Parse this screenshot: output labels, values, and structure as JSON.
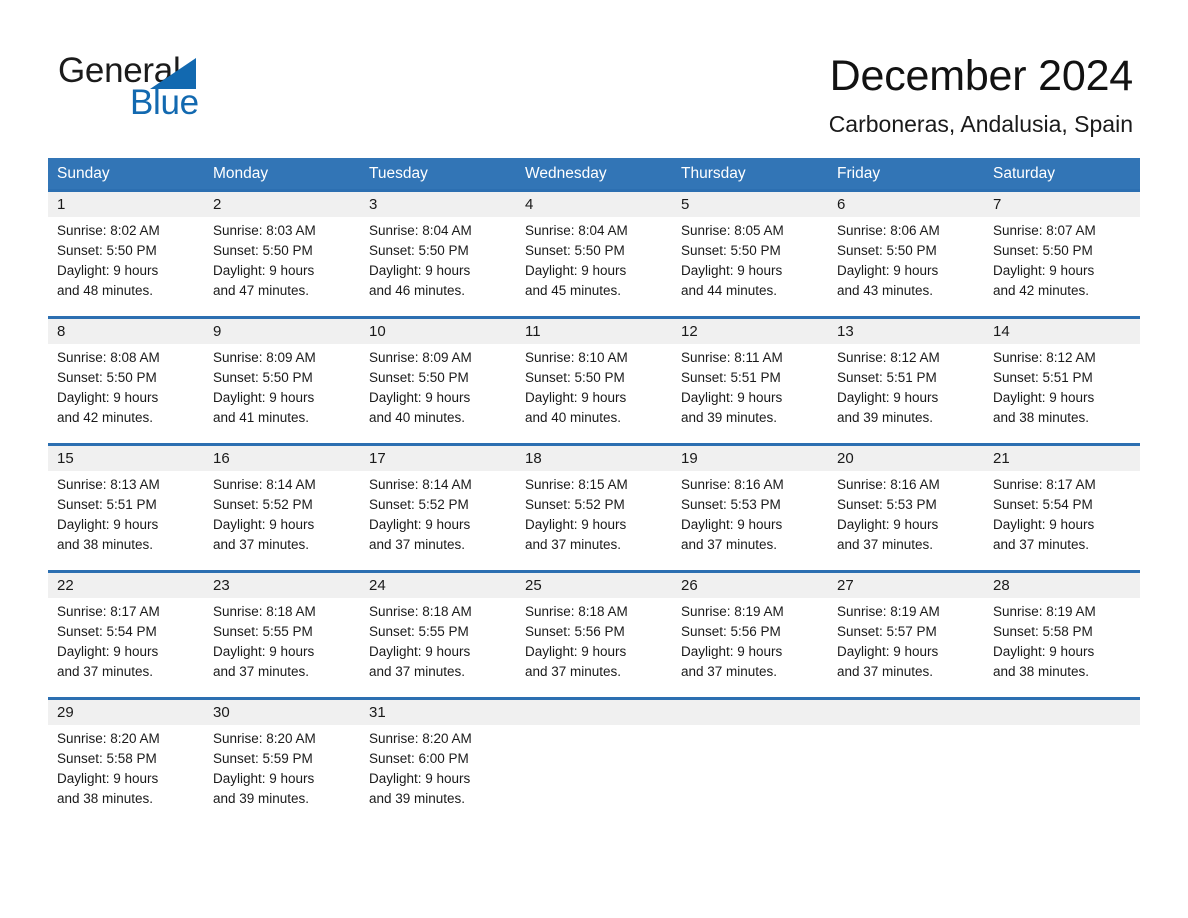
{
  "brand": {
    "name_part1": "General",
    "name_part2": "Blue"
  },
  "header": {
    "month_title": "December 2024",
    "location": "Carboneras, Andalusia, Spain"
  },
  "theme": {
    "header_blue": "#3275b6",
    "row_rule_blue": "#2c6fb1",
    "daynum_band": "#f0f0f0",
    "logo_blue": "#1269b0"
  },
  "weekdays": [
    "Sunday",
    "Monday",
    "Tuesday",
    "Wednesday",
    "Thursday",
    "Friday",
    "Saturday"
  ],
  "labels": {
    "sunrise_prefix": "Sunrise:",
    "sunset_prefix": "Sunset:",
    "daylight_prefix": "Daylight:"
  },
  "weeks": [
    {
      "days": [
        {
          "num": "1",
          "sunrise": "Sunrise: 8:02 AM",
          "sunset": "Sunset: 5:50 PM",
          "daylight1": "Daylight: 9 hours",
          "daylight2": "and 48 minutes."
        },
        {
          "num": "2",
          "sunrise": "Sunrise: 8:03 AM",
          "sunset": "Sunset: 5:50 PM",
          "daylight1": "Daylight: 9 hours",
          "daylight2": "and 47 minutes."
        },
        {
          "num": "3",
          "sunrise": "Sunrise: 8:04 AM",
          "sunset": "Sunset: 5:50 PM",
          "daylight1": "Daylight: 9 hours",
          "daylight2": "and 46 minutes."
        },
        {
          "num": "4",
          "sunrise": "Sunrise: 8:04 AM",
          "sunset": "Sunset: 5:50 PM",
          "daylight1": "Daylight: 9 hours",
          "daylight2": "and 45 minutes."
        },
        {
          "num": "5",
          "sunrise": "Sunrise: 8:05 AM",
          "sunset": "Sunset: 5:50 PM",
          "daylight1": "Daylight: 9 hours",
          "daylight2": "and 44 minutes."
        },
        {
          "num": "6",
          "sunrise": "Sunrise: 8:06 AM",
          "sunset": "Sunset: 5:50 PM",
          "daylight1": "Daylight: 9 hours",
          "daylight2": "and 43 minutes."
        },
        {
          "num": "7",
          "sunrise": "Sunrise: 8:07 AM",
          "sunset": "Sunset: 5:50 PM",
          "daylight1": "Daylight: 9 hours",
          "daylight2": "and 42 minutes."
        }
      ]
    },
    {
      "days": [
        {
          "num": "8",
          "sunrise": "Sunrise: 8:08 AM",
          "sunset": "Sunset: 5:50 PM",
          "daylight1": "Daylight: 9 hours",
          "daylight2": "and 42 minutes."
        },
        {
          "num": "9",
          "sunrise": "Sunrise: 8:09 AM",
          "sunset": "Sunset: 5:50 PM",
          "daylight1": "Daylight: 9 hours",
          "daylight2": "and 41 minutes."
        },
        {
          "num": "10",
          "sunrise": "Sunrise: 8:09 AM",
          "sunset": "Sunset: 5:50 PM",
          "daylight1": "Daylight: 9 hours",
          "daylight2": "and 40 minutes."
        },
        {
          "num": "11",
          "sunrise": "Sunrise: 8:10 AM",
          "sunset": "Sunset: 5:50 PM",
          "daylight1": "Daylight: 9 hours",
          "daylight2": "and 40 minutes."
        },
        {
          "num": "12",
          "sunrise": "Sunrise: 8:11 AM",
          "sunset": "Sunset: 5:51 PM",
          "daylight1": "Daylight: 9 hours",
          "daylight2": "and 39 minutes."
        },
        {
          "num": "13",
          "sunrise": "Sunrise: 8:12 AM",
          "sunset": "Sunset: 5:51 PM",
          "daylight1": "Daylight: 9 hours",
          "daylight2": "and 39 minutes."
        },
        {
          "num": "14",
          "sunrise": "Sunrise: 8:12 AM",
          "sunset": "Sunset: 5:51 PM",
          "daylight1": "Daylight: 9 hours",
          "daylight2": "and 38 minutes."
        }
      ]
    },
    {
      "days": [
        {
          "num": "15",
          "sunrise": "Sunrise: 8:13 AM",
          "sunset": "Sunset: 5:51 PM",
          "daylight1": "Daylight: 9 hours",
          "daylight2": "and 38 minutes."
        },
        {
          "num": "16",
          "sunrise": "Sunrise: 8:14 AM",
          "sunset": "Sunset: 5:52 PM",
          "daylight1": "Daylight: 9 hours",
          "daylight2": "and 37 minutes."
        },
        {
          "num": "17",
          "sunrise": "Sunrise: 8:14 AM",
          "sunset": "Sunset: 5:52 PM",
          "daylight1": "Daylight: 9 hours",
          "daylight2": "and 37 minutes."
        },
        {
          "num": "18",
          "sunrise": "Sunrise: 8:15 AM",
          "sunset": "Sunset: 5:52 PM",
          "daylight1": "Daylight: 9 hours",
          "daylight2": "and 37 minutes."
        },
        {
          "num": "19",
          "sunrise": "Sunrise: 8:16 AM",
          "sunset": "Sunset: 5:53 PM",
          "daylight1": "Daylight: 9 hours",
          "daylight2": "and 37 minutes."
        },
        {
          "num": "20",
          "sunrise": "Sunrise: 8:16 AM",
          "sunset": "Sunset: 5:53 PM",
          "daylight1": "Daylight: 9 hours",
          "daylight2": "and 37 minutes."
        },
        {
          "num": "21",
          "sunrise": "Sunrise: 8:17 AM",
          "sunset": "Sunset: 5:54 PM",
          "daylight1": "Daylight: 9 hours",
          "daylight2": "and 37 minutes."
        }
      ]
    },
    {
      "days": [
        {
          "num": "22",
          "sunrise": "Sunrise: 8:17 AM",
          "sunset": "Sunset: 5:54 PM",
          "daylight1": "Daylight: 9 hours",
          "daylight2": "and 37 minutes."
        },
        {
          "num": "23",
          "sunrise": "Sunrise: 8:18 AM",
          "sunset": "Sunset: 5:55 PM",
          "daylight1": "Daylight: 9 hours",
          "daylight2": "and 37 minutes."
        },
        {
          "num": "24",
          "sunrise": "Sunrise: 8:18 AM",
          "sunset": "Sunset: 5:55 PM",
          "daylight1": "Daylight: 9 hours",
          "daylight2": "and 37 minutes."
        },
        {
          "num": "25",
          "sunrise": "Sunrise: 8:18 AM",
          "sunset": "Sunset: 5:56 PM",
          "daylight1": "Daylight: 9 hours",
          "daylight2": "and 37 minutes."
        },
        {
          "num": "26",
          "sunrise": "Sunrise: 8:19 AM",
          "sunset": "Sunset: 5:56 PM",
          "daylight1": "Daylight: 9 hours",
          "daylight2": "and 37 minutes."
        },
        {
          "num": "27",
          "sunrise": "Sunrise: 8:19 AM",
          "sunset": "Sunset: 5:57 PM",
          "daylight1": "Daylight: 9 hours",
          "daylight2": "and 37 minutes."
        },
        {
          "num": "28",
          "sunrise": "Sunrise: 8:19 AM",
          "sunset": "Sunset: 5:58 PM",
          "daylight1": "Daylight: 9 hours",
          "daylight2": "and 38 minutes."
        }
      ]
    },
    {
      "days": [
        {
          "num": "29",
          "sunrise": "Sunrise: 8:20 AM",
          "sunset": "Sunset: 5:58 PM",
          "daylight1": "Daylight: 9 hours",
          "daylight2": "and 38 minutes."
        },
        {
          "num": "30",
          "sunrise": "Sunrise: 8:20 AM",
          "sunset": "Sunset: 5:59 PM",
          "daylight1": "Daylight: 9 hours",
          "daylight2": "and 39 minutes."
        },
        {
          "num": "31",
          "sunrise": "Sunrise: 8:20 AM",
          "sunset": "Sunset: 6:00 PM",
          "daylight1": "Daylight: 9 hours",
          "daylight2": "and 39 minutes."
        },
        {
          "num": "",
          "sunrise": "",
          "sunset": "",
          "daylight1": "",
          "daylight2": ""
        },
        {
          "num": "",
          "sunrise": "",
          "sunset": "",
          "daylight1": "",
          "daylight2": ""
        },
        {
          "num": "",
          "sunrise": "",
          "sunset": "",
          "daylight1": "",
          "daylight2": ""
        },
        {
          "num": "",
          "sunrise": "",
          "sunset": "",
          "daylight1": "",
          "daylight2": ""
        }
      ]
    }
  ]
}
